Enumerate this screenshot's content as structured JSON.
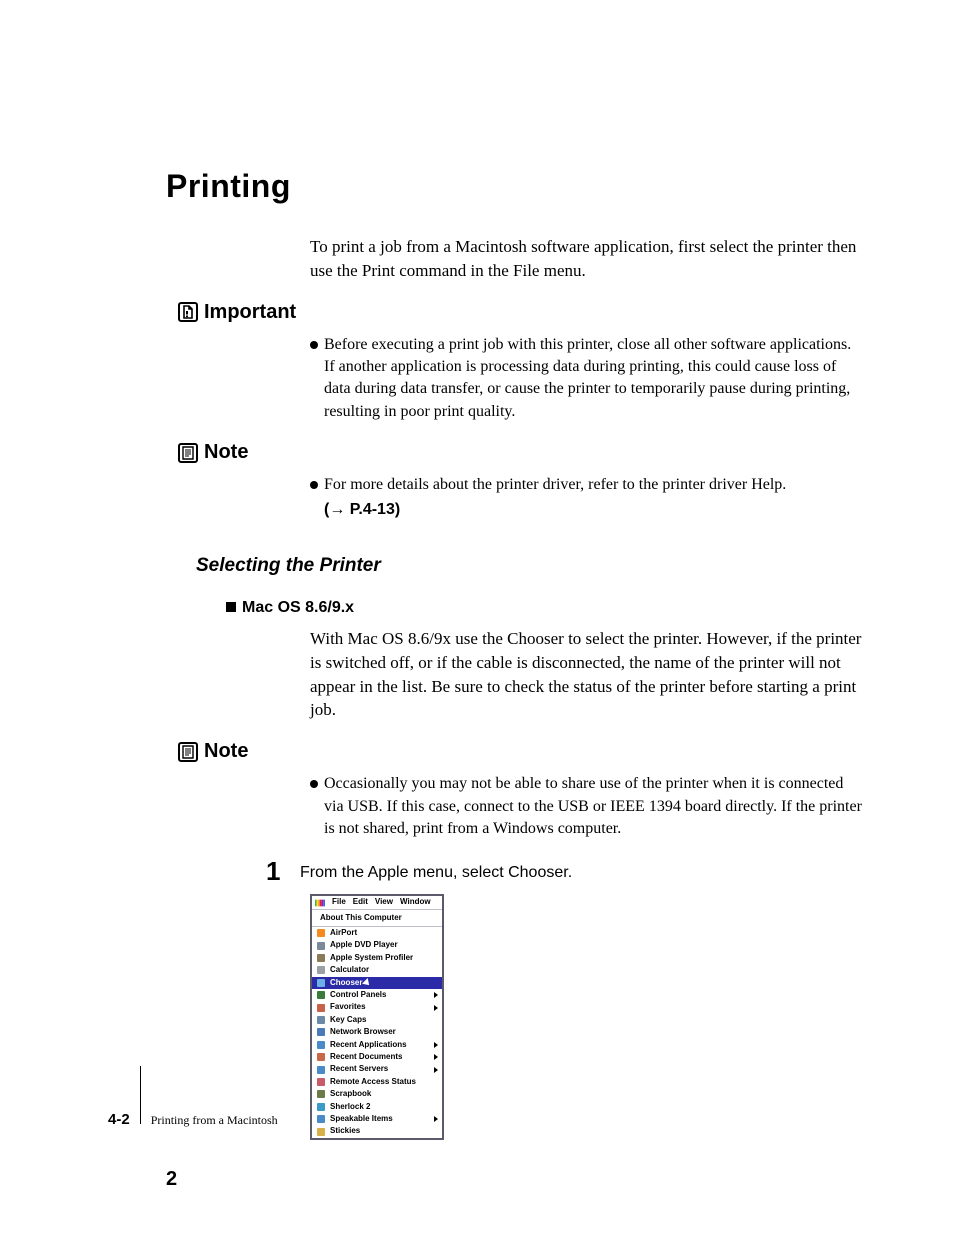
{
  "title": "Printing",
  "intro": "To print a job from a Macintosh software application, first select the printer then use the Print command in the File menu.",
  "important": {
    "label": "Important",
    "bullet": "Before executing a print job with this printer, close all other software applications. If another application is processing data during printing, this could cause loss of data during data transfer, or cause the printer to temporarily pause during printing, resulting in poor print quality."
  },
  "note1": {
    "label": "Note",
    "bullet": "For more details about the printer driver, refer to the printer driver Help.",
    "ref": "(→ P.4-13)"
  },
  "subhead": "Selecting the Printer",
  "os_head": "Mac OS 8.6/9.x",
  "os_body": "With Mac OS 8.6/9x use the Chooser to select the printer. However, if the printer is switched off, or if the cable is disconnected, the name of the printer will not appear in the list. Be sure to check the status of the printer before starting a print job.",
  "note2": {
    "label": "Note",
    "bullet": "Occasionally you may not be able to share use of the printer when it is connected via USB. If this case, connect to the USB or IEEE 1394 board directly. If the printer is not shared, print from a Windows computer."
  },
  "step1": {
    "num": "1",
    "text": "From the Apple menu, select Chooser."
  },
  "menu": {
    "bar": [
      "File",
      "Edit",
      "View",
      "Window"
    ],
    "top": "About This Computer",
    "items": [
      {
        "label": "AirPort",
        "fill": "#f58a1f",
        "sub": false
      },
      {
        "label": "Apple DVD Player",
        "fill": "#7a8a9a",
        "sub": false
      },
      {
        "label": "Apple System Profiler",
        "fill": "#8a7a5a",
        "sub": false
      },
      {
        "label": "Calculator",
        "fill": "#9aa0a6",
        "sub": false
      },
      {
        "label": "Chooser",
        "fill": "#6bb0e8",
        "sub": false,
        "selected": true
      },
      {
        "label": "Control Panels",
        "fill": "#3a7a3a",
        "sub": true
      },
      {
        "label": "Favorites",
        "fill": "#c8604a",
        "sub": true
      },
      {
        "label": "Key Caps",
        "fill": "#6a8aa8",
        "sub": false
      },
      {
        "label": "Network Browser",
        "fill": "#4a7ab8",
        "sub": false
      },
      {
        "label": "Recent Applications",
        "fill": "#4a8ac8",
        "sub": true
      },
      {
        "label": "Recent Documents",
        "fill": "#c86a4a",
        "sub": true
      },
      {
        "label": "Recent Servers",
        "fill": "#4a8ac8",
        "sub": true
      },
      {
        "label": "Remote Access Status",
        "fill": "#c85a6a",
        "sub": false
      },
      {
        "label": "Scrapbook",
        "fill": "#6a7a4a",
        "sub": false
      },
      {
        "label": "Sherlock 2",
        "fill": "#3a9ac8",
        "sub": false
      },
      {
        "label": "Speakable Items",
        "fill": "#4a8ac8",
        "sub": true
      },
      {
        "label": "Stickies",
        "fill": "#d8b048",
        "sub": false
      }
    ]
  },
  "footer": {
    "page": "4-2",
    "chapter": "Printing from a Macintosh",
    "sheet": "2"
  }
}
